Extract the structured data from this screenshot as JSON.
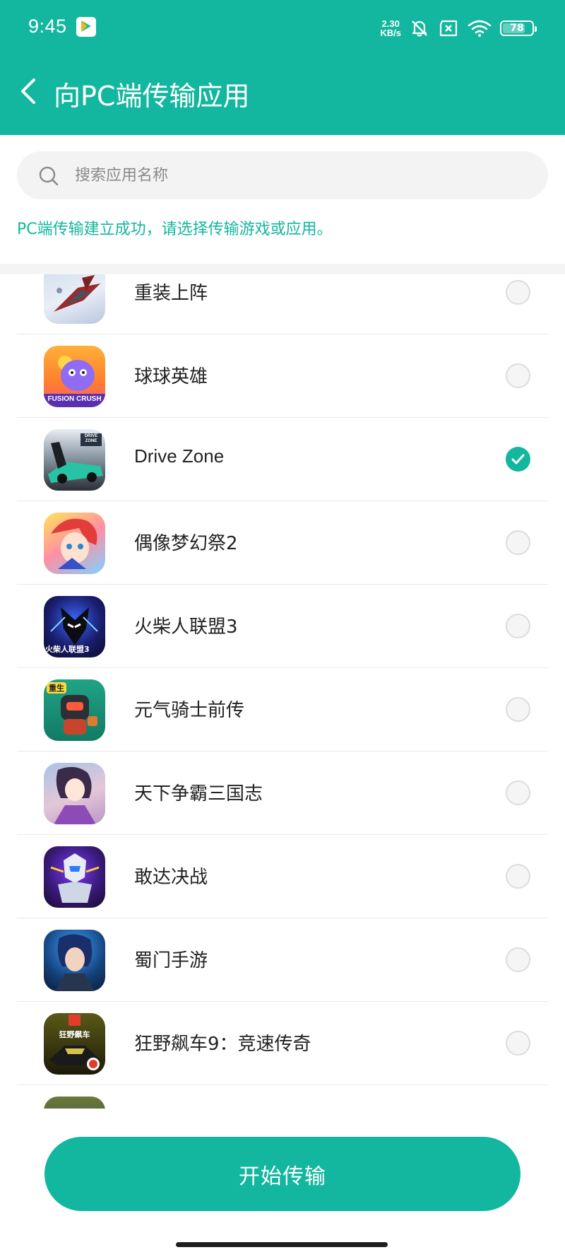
{
  "status_bar": {
    "time": "9:45",
    "net_speed_value": "2.30",
    "net_speed_unit": "KB/s",
    "battery": "78",
    "battery_level_percent": 78
  },
  "header": {
    "title": "向PC端传输应用",
    "back_icon": "chevron-left-icon"
  },
  "search": {
    "placeholder": "搜索应用名称"
  },
  "notice": "PC端传输建立成功，请选择传输游戏或应用。",
  "apps": [
    {
      "name": "重装上阵",
      "checked": false
    },
    {
      "name": "球球英雄",
      "checked": false,
      "icon_text": "FUSION CRUSH"
    },
    {
      "name": "Drive Zone",
      "checked": true,
      "icon_text": "DRIVE ZONE"
    },
    {
      "name": "偶像梦幻祭2",
      "checked": false
    },
    {
      "name": "火柴人联盟3",
      "checked": false,
      "icon_text": "火柴人联盟3"
    },
    {
      "name": "元气骑士前传",
      "checked": false,
      "icon_text": "重生"
    },
    {
      "name": "天下争霸三国志",
      "checked": false
    },
    {
      "name": "敢达决战",
      "checked": false
    },
    {
      "name": "蜀门手游",
      "checked": false
    },
    {
      "name": "狂野飙车9：竞速传奇",
      "checked": false,
      "icon_text": "狂野飙车"
    }
  ],
  "colors": {
    "accent": "#13b69e"
  },
  "start_button": "开始传输"
}
